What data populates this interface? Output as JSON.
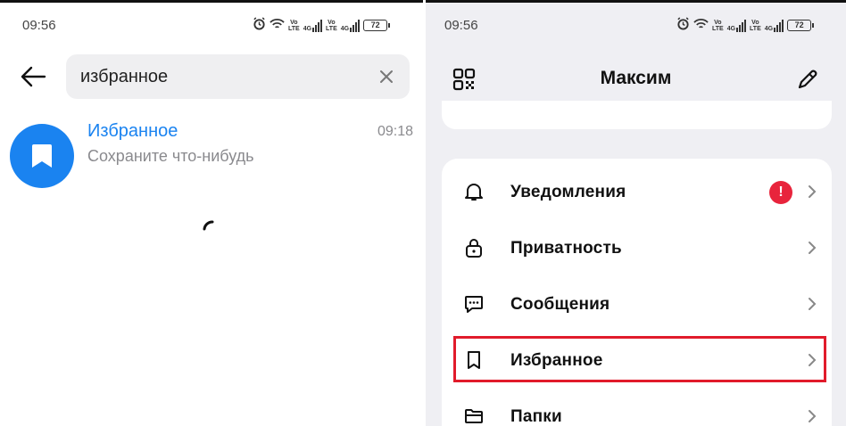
{
  "left": {
    "status_bar": {
      "time": "09:56",
      "net1": "Vo LTE",
      "net2": "4G",
      "battery": "72"
    },
    "search": {
      "query": "избранное"
    },
    "result": {
      "title": "Избранное",
      "subtitle": "Сохраните что-нибудь",
      "time": "09:18"
    }
  },
  "right": {
    "status_bar": {
      "time": "09:56",
      "net1": "Vo LTE",
      "net2": "4G",
      "battery": "72"
    },
    "profile_name": "Максим",
    "menu": [
      {
        "label": "Уведомления",
        "icon": "bell-icon",
        "alert": "!"
      },
      {
        "label": "Приватность",
        "icon": "lock-icon"
      },
      {
        "label": "Сообщения",
        "icon": "chat-icon"
      },
      {
        "label": "Избранное",
        "icon": "bookmark-icon"
      },
      {
        "label": "Папки",
        "icon": "folder-icon"
      }
    ]
  },
  "colors": {
    "accent": "#1a83f0",
    "alert": "#e8243c",
    "highlight": "#e11b2b"
  }
}
